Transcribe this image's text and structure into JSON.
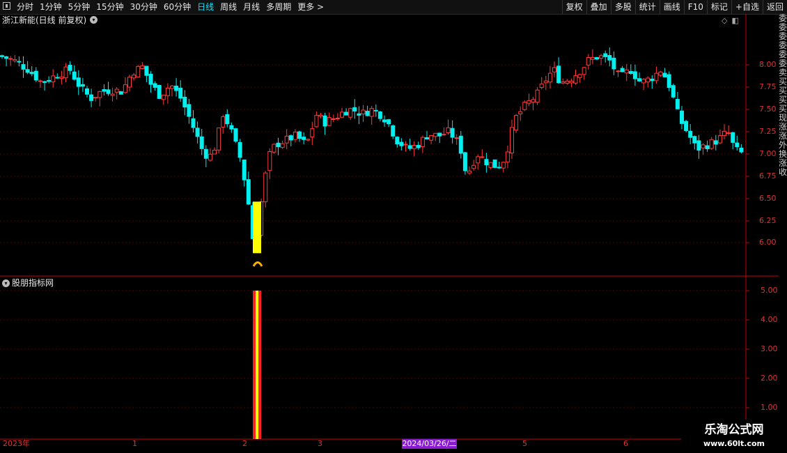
{
  "toolbar": {
    "periods": [
      "分时",
      "1分钟",
      "5分钟",
      "15分钟",
      "30分钟",
      "60分钟",
      "日线",
      "周线",
      "月线",
      "多周期",
      "更多 >"
    ],
    "active_period": "日线",
    "actions": [
      "复权",
      "叠加",
      "多股",
      "统计",
      "画线",
      "F10",
      "标记",
      "+自选",
      "返回"
    ]
  },
  "main": {
    "title": "浙江新能(日线 前复权)",
    "price_ticks": [
      "8.00",
      "7.75",
      "7.50",
      "7.25",
      "7.00",
      "6.75",
      "6.50",
      "6.25",
      "6.00"
    ]
  },
  "indicator": {
    "title": "股朋指标网",
    "ticks": [
      "5.00",
      "4.00",
      "3.00",
      "2.00",
      "1.00"
    ]
  },
  "xaxis": {
    "labels": [
      "2023年",
      "1",
      "2",
      "3",
      "5",
      "6"
    ],
    "cursor_date": "2024/03/26/二"
  },
  "watermark": {
    "line1": "乐淘公式网",
    "line2": "www.60lt.com"
  },
  "colors": {
    "up": "#ff3a3a",
    "down": "#00f0f0",
    "signal": "#ffff00",
    "bar_outer": "#ff2020",
    "grid": "#5a0000"
  },
  "chart_data": {
    "type": "candlestick",
    "ylim": [
      5.75,
      8.25
    ],
    "signal_range": [
      5.88,
      6.46
    ],
    "indicator_value": 5,
    "indicator_ylim": [
      0,
      5.5
    ]
  }
}
